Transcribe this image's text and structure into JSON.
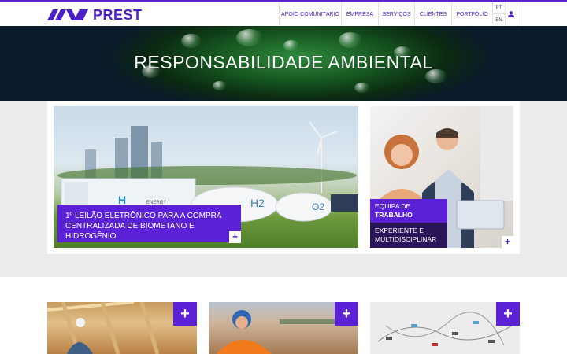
{
  "brand": {
    "name": "PREST",
    "color": "#5b21d6",
    "dark": "#2a1458"
  },
  "nav": {
    "items": [
      "APOIO COMUNITÁRIO",
      "EMPRESA",
      "SERVIÇOS",
      "CLIENTES",
      "PORTFÓLIO"
    ],
    "lang": [
      "PT",
      "EN"
    ],
    "user_icon": "user-icon"
  },
  "hero": {
    "title": "RESPONSABILIDADE AMBIENTAL"
  },
  "featured": [
    {
      "caption": "1º LEILÃO ELETRÔNICO PARA A COMPRA CENTRALIZADA DE BIOMETANO E HIDROGÊNIO",
      "tank_labels": [
        "H2",
        "O2"
      ],
      "plus": "+"
    },
    {
      "caption_title_line1": "EQUIPA DE",
      "caption_title_line2": "TRABALHO",
      "caption_sub": "EXPERIENTE E MULTIDISCIPLINAR",
      "plus": "+"
    }
  ],
  "tiles": [
    {
      "name": "construction-tile",
      "plus": "+"
    },
    {
      "name": "engineer-tile",
      "plus": "+"
    },
    {
      "name": "network-map-tile",
      "plus": "+"
    }
  ]
}
